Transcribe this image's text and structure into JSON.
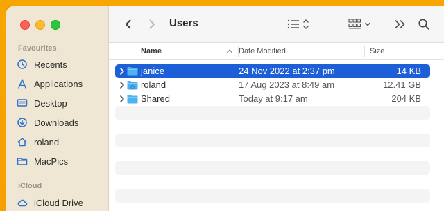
{
  "window": {
    "title": "Users"
  },
  "sidebar": {
    "sections": [
      {
        "label": "Favourites",
        "items": [
          {
            "label": "Recents",
            "icon": "clock-icon"
          },
          {
            "label": "Applications",
            "icon": "applications-icon"
          },
          {
            "label": "Desktop",
            "icon": "desktop-icon"
          },
          {
            "label": "Downloads",
            "icon": "downloads-icon"
          },
          {
            "label": "roland",
            "icon": "home-icon"
          },
          {
            "label": "MacPics",
            "icon": "folder-icon"
          }
        ]
      },
      {
        "label": "iCloud",
        "items": [
          {
            "label": "iCloud Drive",
            "icon": "cloud-icon"
          }
        ]
      }
    ]
  },
  "columns": {
    "name": "Name",
    "date": "Date Modified",
    "size": "Size"
  },
  "files": [
    {
      "name": "janice",
      "date": "24 Nov 2022 at 2:37 pm",
      "size": "14 KB",
      "selected": true
    },
    {
      "name": "roland",
      "date": "17 Aug 2023 at 8:49 am",
      "size": "12.41 GB",
      "selected": false
    },
    {
      "name": "Shared",
      "date": "Today at 9:17 am",
      "size": "204 KB",
      "selected": false
    }
  ],
  "colors": {
    "accent": "#1d5fd6",
    "folder": "#4fb2f0",
    "sidebar_icon": "#2f6fd0",
    "wallpaper": "#f7a600"
  }
}
